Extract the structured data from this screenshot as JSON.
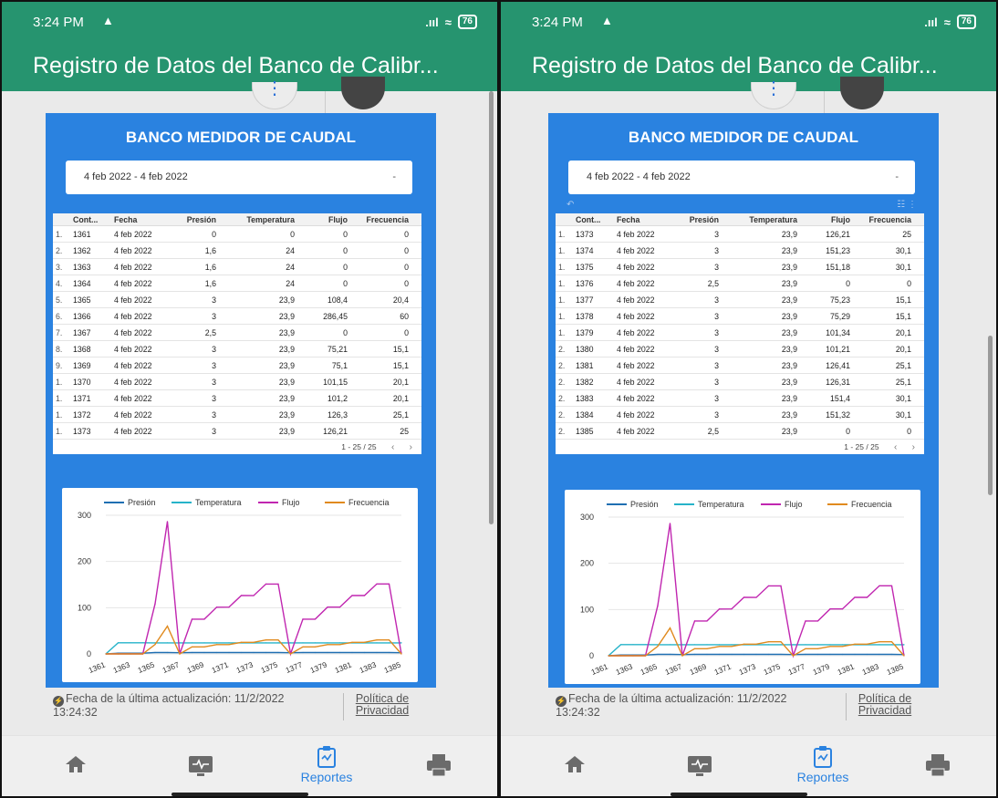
{
  "status": {
    "time": "3:24 PM",
    "alarm_icon": "bell-icon",
    "battery": "76"
  },
  "app": {
    "title": "Registro de Datos del Banco de Calibr..."
  },
  "report": {
    "title": "BANCO MEDIDOR DE CAUDAL",
    "date_range": "4 feb 2022 - 4 feb 2022",
    "dropdown_glyph": "-",
    "columns": [
      "Cont...",
      "Fecha",
      "Presión",
      "Temperatura",
      "Flujo",
      "Frecuencia"
    ],
    "pagination": "1 - 25 / 25"
  },
  "screenL": {
    "rows": [
      [
        "1.",
        "1361",
        "4 feb 2022",
        "0",
        "0",
        "0",
        "0"
      ],
      [
        "2.",
        "1362",
        "4 feb 2022",
        "1,6",
        "24",
        "0",
        "0"
      ],
      [
        "3.",
        "1363",
        "4 feb 2022",
        "1,6",
        "24",
        "0",
        "0"
      ],
      [
        "4.",
        "1364",
        "4 feb 2022",
        "1,6",
        "24",
        "0",
        "0"
      ],
      [
        "5.",
        "1365",
        "4 feb 2022",
        "3",
        "23,9",
        "108,4",
        "20,4"
      ],
      [
        "6.",
        "1366",
        "4 feb 2022",
        "3",
        "23,9",
        "286,45",
        "60"
      ],
      [
        "7.",
        "1367",
        "4 feb 2022",
        "2,5",
        "23,9",
        "0",
        "0"
      ],
      [
        "8.",
        "1368",
        "4 feb 2022",
        "3",
        "23,9",
        "75,21",
        "15,1"
      ],
      [
        "9.",
        "1369",
        "4 feb 2022",
        "3",
        "23,9",
        "75,1",
        "15,1"
      ],
      [
        "1.",
        "1370",
        "4 feb 2022",
        "3",
        "23,9",
        "101,15",
        "20,1"
      ],
      [
        "1.",
        "1371",
        "4 feb 2022",
        "3",
        "23,9",
        "101,2",
        "20,1"
      ],
      [
        "1.",
        "1372",
        "4 feb 2022",
        "3",
        "23,9",
        "126,3",
        "25,1"
      ],
      [
        "1.",
        "1373",
        "4 feb 2022",
        "3",
        "23,9",
        "126,21",
        "25"
      ]
    ]
  },
  "screenR": {
    "rows": [
      [
        "1.",
        "1373",
        "4 feb 2022",
        "3",
        "23,9",
        "126,21",
        "25"
      ],
      [
        "1.",
        "1374",
        "4 feb 2022",
        "3",
        "23,9",
        "151,23",
        "30,1"
      ],
      [
        "1.",
        "1375",
        "4 feb 2022",
        "3",
        "23,9",
        "151,18",
        "30,1"
      ],
      [
        "1.",
        "1376",
        "4 feb 2022",
        "2,5",
        "23,9",
        "0",
        "0"
      ],
      [
        "1.",
        "1377",
        "4 feb 2022",
        "3",
        "23,9",
        "75,23",
        "15,1"
      ],
      [
        "1.",
        "1378",
        "4 feb 2022",
        "3",
        "23,9",
        "75,29",
        "15,1"
      ],
      [
        "1.",
        "1379",
        "4 feb 2022",
        "3",
        "23,9",
        "101,34",
        "20,1"
      ],
      [
        "2.",
        "1380",
        "4 feb 2022",
        "3",
        "23,9",
        "101,21",
        "20,1"
      ],
      [
        "2.",
        "1381",
        "4 feb 2022",
        "3",
        "23,9",
        "126,41",
        "25,1"
      ],
      [
        "2.",
        "1382",
        "4 feb 2022",
        "3",
        "23,9",
        "126,31",
        "25,1"
      ],
      [
        "2.",
        "1383",
        "4 feb 2022",
        "3",
        "23,9",
        "151,4",
        "30,1"
      ],
      [
        "2.",
        "1384",
        "4 feb 2022",
        "3",
        "23,9",
        "151,32",
        "30,1"
      ],
      [
        "2.",
        "1385",
        "4 feb 2022",
        "2,5",
        "23,9",
        "0",
        "0"
      ]
    ]
  },
  "chart_data": {
    "type": "line",
    "x": [
      "1361",
      "1362",
      "1363",
      "1364",
      "1365",
      "1366",
      "1367",
      "1368",
      "1369",
      "1370",
      "1371",
      "1372",
      "1373",
      "1374",
      "1375",
      "1376",
      "1377",
      "1378",
      "1379",
      "1380",
      "1381",
      "1382",
      "1383",
      "1384",
      "1385"
    ],
    "xtick_labels": [
      "1361",
      "1363",
      "1365",
      "1367",
      "1369",
      "1371",
      "1373",
      "1375",
      "1377",
      "1379",
      "1381",
      "1383",
      "1385"
    ],
    "ylim": [
      0,
      300
    ],
    "yticks": [
      "0",
      "100",
      "200",
      "300"
    ],
    "legend_position": "top",
    "grid": true,
    "series": [
      {
        "name": "Presión",
        "color": "#1f6fb2",
        "values": [
          0,
          1.6,
          1.6,
          1.6,
          3,
          3,
          2.5,
          3,
          3,
          3,
          3,
          3,
          3,
          3,
          3,
          2.5,
          3,
          3,
          3,
          3,
          3,
          3,
          3,
          3,
          2.5
        ]
      },
      {
        "name": "Temperatura",
        "color": "#26b3c9",
        "values": [
          0,
          24,
          24,
          24,
          23.9,
          23.9,
          23.9,
          23.9,
          23.9,
          23.9,
          23.9,
          23.9,
          23.9,
          23.9,
          23.9,
          23.9,
          23.9,
          23.9,
          23.9,
          23.9,
          23.9,
          23.9,
          23.9,
          23.9,
          23.9
        ]
      },
      {
        "name": "Flujo",
        "color": "#c026b0",
        "values": [
          0,
          0,
          0,
          0,
          108.4,
          286.45,
          0,
          75.21,
          75.1,
          101.15,
          101.2,
          126.3,
          126.21,
          151.23,
          151.18,
          0,
          75.23,
          75.29,
          101.34,
          101.21,
          126.41,
          126.31,
          151.4,
          151.32,
          0
        ]
      },
      {
        "name": "Frecuencia",
        "color": "#e08a1e",
        "values": [
          0,
          0,
          0,
          0,
          20.4,
          60,
          0,
          15.1,
          15.1,
          20.1,
          20.1,
          25.1,
          25,
          30.1,
          30.1,
          0,
          15.1,
          15.1,
          20.1,
          20.1,
          25.1,
          25.1,
          30.1,
          30.1,
          0
        ]
      }
    ]
  },
  "footer": {
    "update_label": "Fecha de la última actualización: 11/2/2022 13:24:32",
    "policy_label": "Política de Privacidad"
  },
  "nav": {
    "reports_label": "Reportes",
    "home_icon": "home-icon",
    "monitor_icon": "monitor-icon",
    "reports_icon": "clipboard-icon",
    "print_icon": "printer-icon"
  }
}
